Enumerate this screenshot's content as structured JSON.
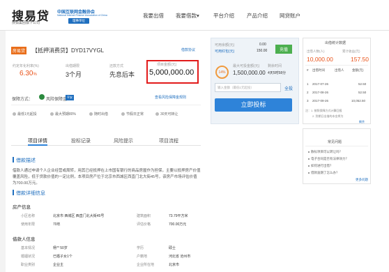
{
  "header": {
    "logo": "搜易贷",
    "logo_sub": "搜狐集团旗下公司",
    "assoc": "中国互联网金融协会",
    "assoc_en": "National Internet Finance Association of China",
    "member": "理事单位",
    "nav": [
      "我要出借",
      "我要借款",
      "平台介绍",
      "产品介绍",
      "网贷账户"
    ],
    "nav_dropdown": "▾"
  },
  "loan": {
    "tag": "房易贷",
    "title": "【抵押消费贷】DYD17VYGL",
    "agreement_link": "借款协议",
    "rate_label": "约定年化利率(%)",
    "rate_value": "6.30",
    "rate_unit": "%",
    "term_label": "出借期限",
    "term_value": "3个月",
    "repay_label": "还款方式",
    "repay_value": "先息后本",
    "amount_label": "项目金额(元)",
    "amount_value": "5,000,000.00",
    "guarantee_label": "保障方式：",
    "guarantee_value": "风险保障金",
    "pinan": "平安",
    "risk_link": "查看风险保障金规则",
    "features": [
      "最低1元起投",
      "最大预期80%",
      "随时出借",
      "节假日正常",
      "30天可转让"
    ]
  },
  "invest": {
    "avail_label": "可用余额(元)",
    "avail_value": "0.00",
    "coupon_label": "可用红包(元)",
    "coupon_value": "150.00",
    "recharge": "充值",
    "progress": "14%",
    "max_label": "最大可投金额(元)",
    "max_value": "1,500,000.00",
    "time_label": "剩余时间",
    "time_value": "4天5时58分",
    "input_placeholder": "输入金额（最低1元起投）",
    "all_link": "全投",
    "button": "立即投标"
  },
  "stats": {
    "title": "出借统计数据",
    "count_label": "出借人数(人)",
    "count_value": "10,000.00",
    "income_label": "累计收益(元)",
    "income_value": "157.50",
    "table_header": [
      "#",
      "出借时间",
      "出借人",
      "金额(元)"
    ],
    "rows": [
      [
        "1",
        "2017-07-26",
        "",
        "52.50"
      ],
      [
        "2",
        "2017-08-26",
        "",
        "52.50"
      ],
      [
        "3",
        "2017-09-26",
        "",
        "10,052.50"
      ]
    ],
    "note1": "注：1. 按照保障方式计算回报",
    "note2": "2. 到期日出借的本金将为",
    "remark": "剩余"
  },
  "tabs": [
    "项目详情",
    "投标记录",
    "风险提示",
    "项目流程"
  ],
  "detail": {
    "desc_title": "借款描述",
    "desc_text": "借款人通过申请个人企业经营或周转，用其已经抵押在上市国有银行的商品房屋作为担保，主要以抵押房产价值覆盖风险，低于贷款价值的一定比例，本项目房产位于北京市西城区西直门北大街45号，该房产市场评估价值为700.00万元。",
    "detail_title": "借款详细信息",
    "house_title": "房产信息",
    "house_rows": [
      [
        "小区名称",
        "北京市 西城区 西直门北大街45号",
        "建筑面积",
        "73.79平方米"
      ],
      [
        "使用年限",
        "70年",
        "评估价格",
        "700.00万元"
      ]
    ],
    "person_title": "借款人信息",
    "person_rows": [
      [
        "基本情况",
        "杨** 50岁",
        "学历",
        "硕士"
      ],
      [
        "婚姻状况",
        "已婚子女1个",
        "户籍地",
        "河北省 沧州市"
      ],
      [
        "职业类别",
        "企业主",
        "企业所在地",
        "北京市"
      ]
    ]
  },
  "faq": {
    "title": "常见问题",
    "items": [
      "散标项目可以转让吗？",
      "电子合同是否有法律效力？",
      "如何进行出借？",
      "借款逾期了怎么办？"
    ],
    "more": "更多问题"
  }
}
